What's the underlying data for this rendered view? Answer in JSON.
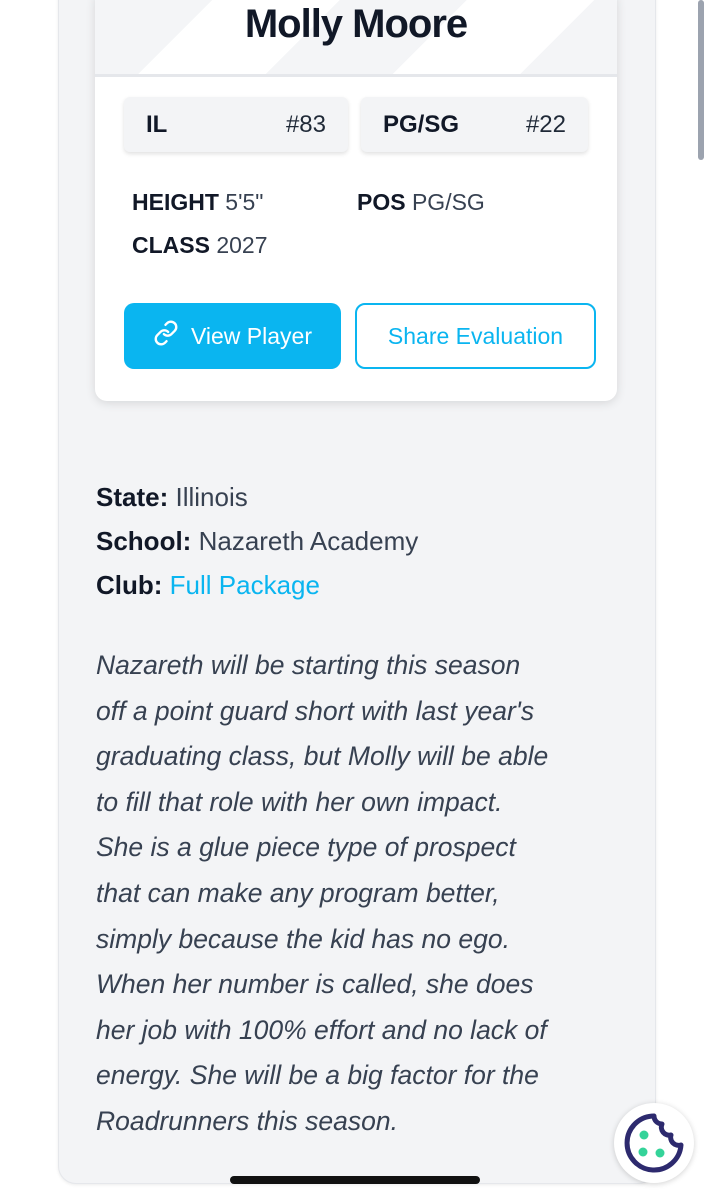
{
  "player": {
    "name": "Molly Moore",
    "state_code": "IL",
    "state_number": "#83",
    "position_chip": "PG/SG",
    "position_number": "#22"
  },
  "stats": {
    "height_label": "HEIGHT",
    "height_value": "5'5\"",
    "pos_label": "POS",
    "pos_value": "PG/SG",
    "class_label": "CLASS",
    "class_value": "2027"
  },
  "buttons": {
    "view_player": "View Player",
    "share_evaluation": "Share Evaluation"
  },
  "details": {
    "state_label": "State:",
    "state_value": "Illinois",
    "school_label": "School:",
    "school_value": "Nazareth Academy",
    "club_label": "Club:",
    "club_value": "Full Package"
  },
  "evaluation": {
    "lines": [
      "Nazareth will be starting this season",
      "off a point guard short with last year's",
      "graduating class, but Molly will be able",
      "to fill that role with her own impact.",
      "She is a glue piece type of prospect",
      "that can make any program better,",
      "simply because the kid has no ego.",
      "When her number is called, she does",
      "her job with 100% effort and no lack of",
      "energy. She will be a big factor for the",
      "Roadrunners this season."
    ]
  },
  "colors": {
    "accent": "#0ab5f0",
    "panel_bg": "#f3f4f6",
    "cookie_icon": "#2d2a6e",
    "cookie_dots": "#34d399"
  },
  "icons": {
    "view_player": "link-icon",
    "cookie": "cookie-icon"
  }
}
